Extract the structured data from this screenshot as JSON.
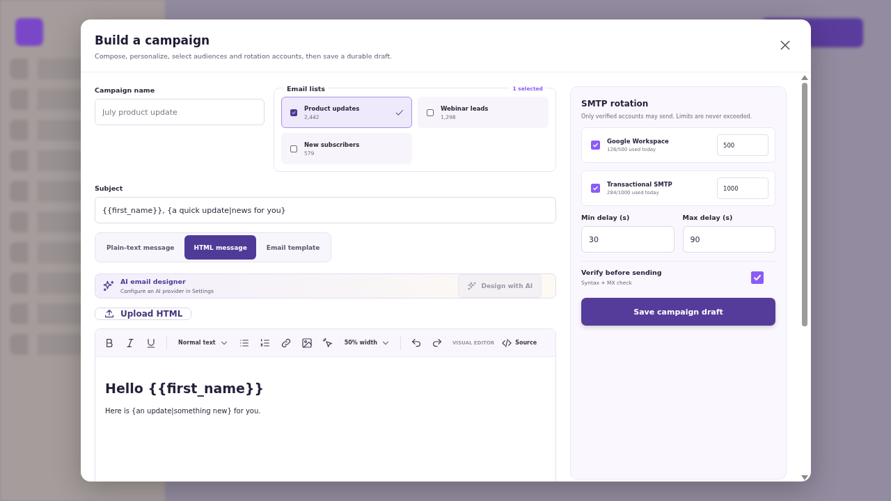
{
  "dialog": {
    "title": "Build a campaign",
    "subtitle": "Compose, personalize, select audiences and rotation accounts, then save a durable draft."
  },
  "campaign_name": {
    "label": "Campaign name",
    "placeholder": "July product update"
  },
  "email_lists": {
    "label": "Email lists",
    "count": "1 selected",
    "items": [
      {
        "name": "Product updates",
        "count": "2,442",
        "selected": true
      },
      {
        "name": "Webinar leads",
        "count": "1,298",
        "selected": false
      },
      {
        "name": "New subscribers",
        "count": "579",
        "selected": false
      }
    ]
  },
  "subject": {
    "label": "Subject",
    "value": "{{first_name}}, {a quick update|news for you}"
  },
  "message_tabs": [
    {
      "label": "Plain-text message",
      "selected": false
    },
    {
      "label": "HTML message",
      "selected": true
    },
    {
      "label": "Email template",
      "selected": false
    }
  ],
  "ai_designer": {
    "title": "AI email designer",
    "subtitle": "Configure an AI provider in Settings",
    "button": "Design with AI",
    "disabled": true
  },
  "upload_button": "Upload HTML",
  "editor": {
    "text_style": "Normal text",
    "image_width": "50% width",
    "mode": "VISUAL EDITOR",
    "source": "Source",
    "heading": "Hello {{first_name}}",
    "paragraph": "Here is {an update|something new} for you."
  },
  "smtp": {
    "title": "SMTP rotation",
    "subtitle": "Only verified accounts may send. Limits are never exceeded.",
    "accounts": [
      {
        "name": "Google Workspace",
        "usage": "126/500 used today",
        "limit": "500",
        "checked": true
      },
      {
        "name": "Transactional SMTP",
        "usage": "284/1000 used today",
        "limit": "1000",
        "checked": true
      }
    ],
    "min_delay": {
      "label": "Min delay (s)",
      "value": "30"
    },
    "max_delay": {
      "label": "Max delay (s)",
      "value": "90"
    },
    "verify": {
      "label": "Verify before sending",
      "hint": "Syntax + MX check",
      "checked": true
    },
    "save_button": "Save campaign draft"
  }
}
